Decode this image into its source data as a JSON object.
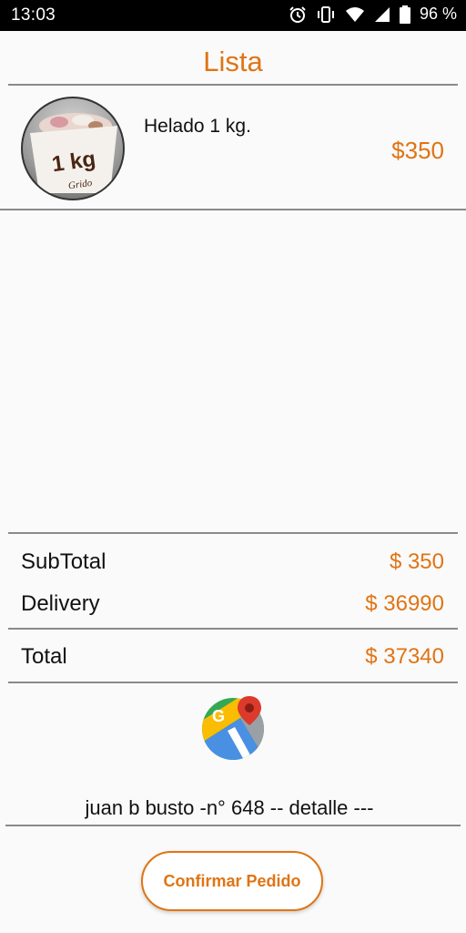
{
  "status_bar": {
    "time": "13:03",
    "battery": "96 %",
    "icons": [
      "alarm-icon",
      "vibrate-icon",
      "wifi-icon",
      "signal-icon",
      "battery-icon"
    ]
  },
  "header": {
    "title": "Lista"
  },
  "cart": {
    "items": [
      {
        "name": "Helado 1 kg.",
        "price": "$350",
        "image_text": "1 kg",
        "image_brand": "Grido"
      }
    ]
  },
  "summary": {
    "subtotal_label": "SubTotal",
    "subtotal_value": "$ 350",
    "delivery_label": "Delivery",
    "delivery_value": "$ 36990",
    "total_label": "Total",
    "total_value": "$ 37340"
  },
  "location": {
    "icon": "google-maps-icon",
    "address": "juan b busto  -n° 648 -- detalle ---"
  },
  "actions": {
    "confirm_label": "Confirmar Pedido"
  },
  "colors": {
    "accent": "#e07414",
    "divider": "#8a8a8a",
    "background": "#fafafa"
  }
}
